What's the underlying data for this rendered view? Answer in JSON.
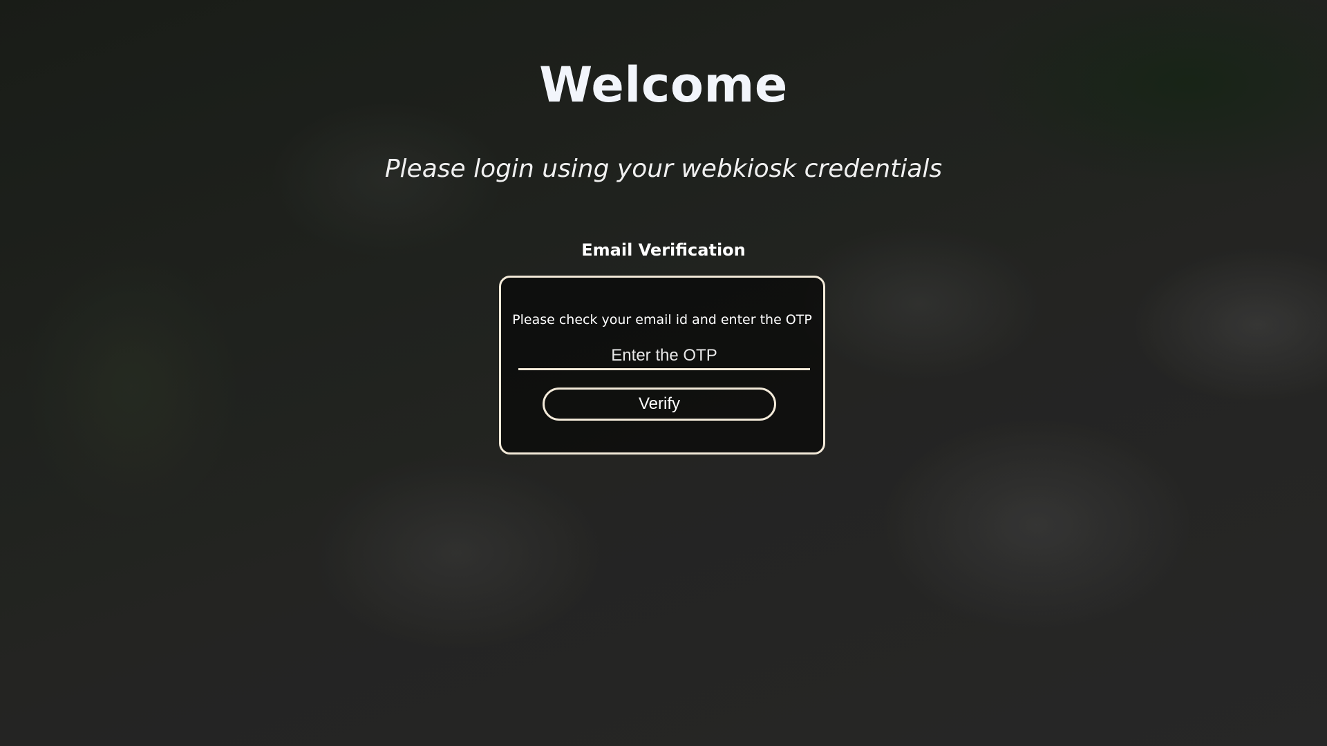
{
  "header": {
    "title": "Welcome",
    "subtitle": "Please login using your webkiosk credentials"
  },
  "verification": {
    "section_title": "Email Verification",
    "instruction": "Please check your email id and enter the OTP",
    "otp_input": {
      "placeholder": "Enter the OTP",
      "value": ""
    },
    "verify_label": "Verify"
  },
  "colors": {
    "text": "#ffffff",
    "title": "#f2f5fb",
    "border_accent": "#f3ead9"
  },
  "background": {
    "description_icon": "aerial-campus-image"
  }
}
